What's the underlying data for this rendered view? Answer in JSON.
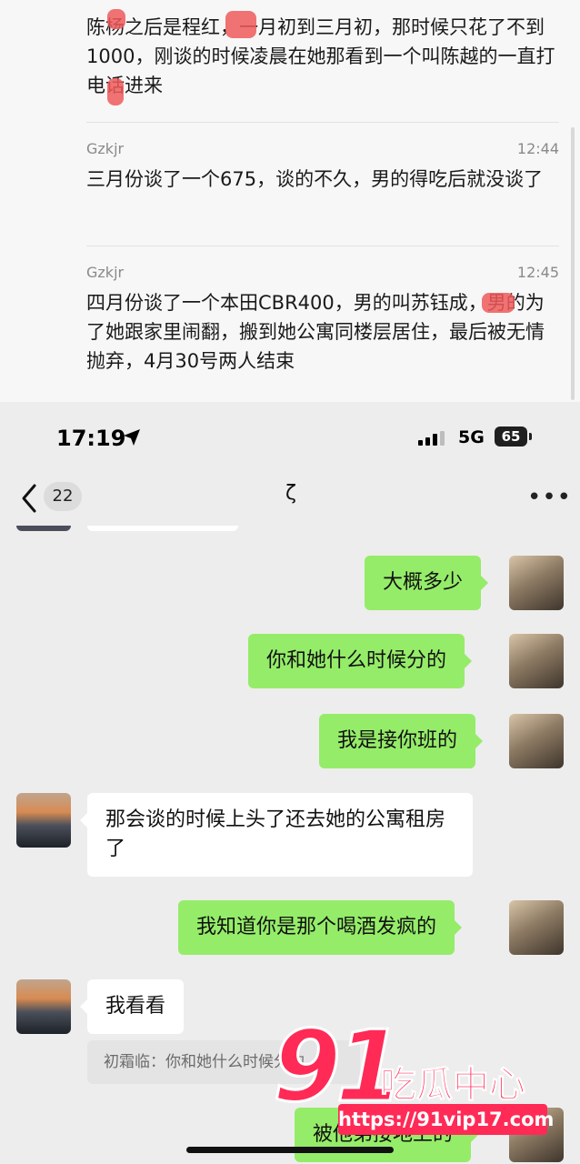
{
  "top_screenshot": {
    "records": [
      {
        "name": "",
        "time": "",
        "text": "陈杨之后是程红，一月初到三月初，那时候只花了不到1000，刚谈的时候凌晨在她那看到一个叫陈越的一直打电话进来"
      },
      {
        "name": "Gzkjr",
        "time": "12:44",
        "text": "三月份谈了一个675，谈的不久，男的得吃后就没谈了"
      },
      {
        "name": "Gzkjr",
        "time": "12:45",
        "text": "四月份谈了一个本田CBR400，男的叫苏钰成，男的为了她跟家里闹翻，搬到她公寓同楼层居住，最后被无情抛弃，4月30号两人结束"
      }
    ]
  },
  "status_bar": {
    "time": "17:19",
    "network": "5G",
    "battery": "65"
  },
  "nav": {
    "back_count": "22",
    "title": "ζ",
    "more": "•••"
  },
  "messages": [
    {
      "side": "out",
      "text": "大概多少"
    },
    {
      "side": "out",
      "text": "你和她什么时候分的"
    },
    {
      "side": "out",
      "text": "我是接你班的"
    },
    {
      "side": "in",
      "text": "那会谈的时候上头了还去她的公寓租房了"
    },
    {
      "side": "out",
      "text": "我知道你是那个喝酒发疯的"
    },
    {
      "side": "in",
      "text": "我看看"
    },
    {
      "side": "quote",
      "text": "初霜临：你和她什么时候分的"
    },
    {
      "side": "out",
      "text": "被他弟接地上的"
    }
  ],
  "watermark": {
    "number": "91",
    "text": "吃瓜中心",
    "url": "https://91vip17.com"
  },
  "colors": {
    "bubble_out": "#95ec69",
    "bubble_in": "#ffffff",
    "watermark": "#ff2a56"
  }
}
